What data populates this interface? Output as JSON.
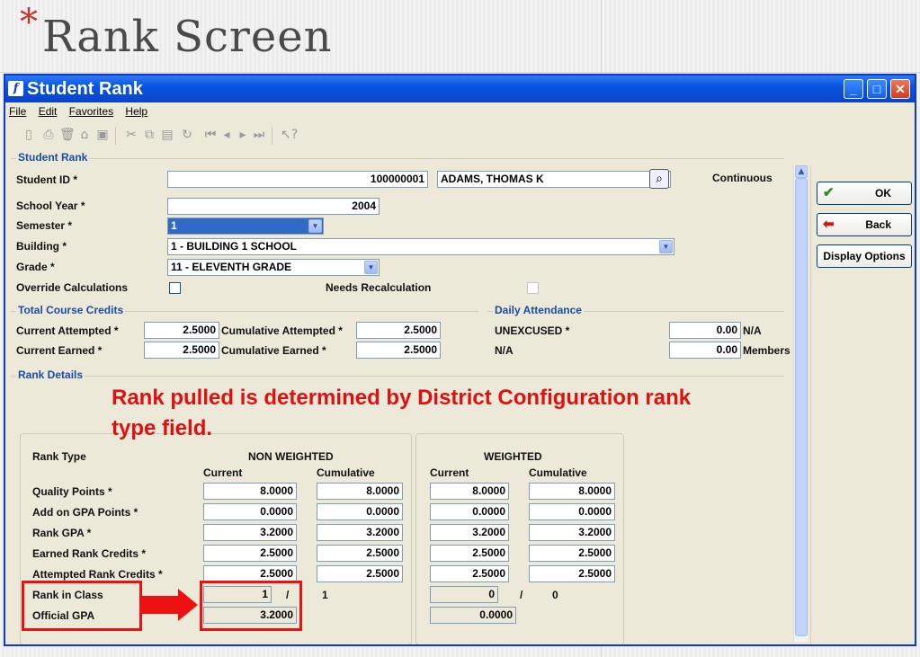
{
  "slide": {
    "title": "Rank Screen",
    "bullet": "*"
  },
  "window": {
    "title": "Student Rank",
    "minimize": "_",
    "maximize": "□",
    "close": "✕"
  },
  "menu": [
    "File",
    "Edit",
    "Favorites",
    "Help"
  ],
  "student_rank": {
    "legend": "Student Rank",
    "student_id_label": "Student ID *",
    "student_id": "100000001",
    "student_name": "ADAMS, THOMAS K",
    "continuous": "Continuous",
    "school_year_label": "School Year *",
    "school_year": "2004",
    "semester_label": "Semester *",
    "semester": "1",
    "building_label": "Building *",
    "building": "1 - BUILDING 1 SCHOOL",
    "grade_label": "Grade *",
    "grade": "11 - ELEVENTH GRADE",
    "override_label": "Override Calculations",
    "needs_recalc_label": "Needs Recalculation"
  },
  "credits": {
    "legend": "Total Course Credits",
    "current_attempted_label": "Current Attempted *",
    "current_attempted": "2.5000",
    "cumulative_attempted_label": "Cumulative Attempted *",
    "cumulative_attempted": "2.5000",
    "current_earned_label": "Current Earned *",
    "current_earned": "2.5000",
    "cumulative_earned_label": "Cumulative Earned *",
    "cumulative_earned": "2.5000"
  },
  "attendance": {
    "legend": "Daily Attendance",
    "unexcused_label": "UNEXCUSED *",
    "unexcused": "0.00",
    "unexcused_unit": "N/A",
    "na_label": "N/A",
    "na_value": "0.00",
    "na_unit": "Members"
  },
  "rank_details": {
    "legend": "Rank Details",
    "rank_type_label": "Rank Type",
    "non_weighted": "NON WEIGHTED",
    "weighted": "WEIGHTED",
    "current": "Current",
    "cumulative": "Cumulative",
    "rows": [
      {
        "label": "Quality Points *",
        "nw_cur": "8.0000",
        "nw_cum": "8.0000",
        "w_cur": "8.0000",
        "w_cum": "8.0000"
      },
      {
        "label": "Add on GPA Points *",
        "nw_cur": "0.0000",
        "nw_cum": "0.0000",
        "w_cur": "0.0000",
        "w_cum": "0.0000"
      },
      {
        "label": "Rank GPA *",
        "nw_cur": "3.2000",
        "nw_cum": "3.2000",
        "w_cur": "3.2000",
        "w_cum": "3.2000"
      },
      {
        "label": "Earned Rank Credits *",
        "nw_cur": "2.5000",
        "nw_cum": "2.5000",
        "w_cur": "2.5000",
        "w_cum": "2.5000"
      },
      {
        "label": "Attempted Rank Credits *",
        "nw_cur": "2.5000",
        "nw_cum": "2.5000",
        "w_cur": "2.5000",
        "w_cum": "2.5000"
      }
    ],
    "rank_in_class_label": "Rank in Class",
    "nw_rank": "1",
    "nw_rank_sep": "/",
    "nw_class_size": "1",
    "w_rank": "0",
    "w_rank_sep": "/",
    "w_class_size": "0",
    "official_gpa_label": "Official GPA",
    "nw_official_gpa": "3.2000",
    "w_official_gpa": "0.0000"
  },
  "annotation": {
    "line1": "Rank pulled is determined by District Configuration rank",
    "line2": "type field."
  },
  "side_buttons": {
    "ok": "OK",
    "back": "Back",
    "display_options": "Display Options"
  },
  "icons": [
    "app-icon",
    "new-icon",
    "print-icon",
    "delete-icon",
    "open-icon",
    "save-icon",
    "cut-icon",
    "copy-icon",
    "paste-icon",
    "refresh-icon",
    "first-icon",
    "prev-icon",
    "next-icon",
    "last-icon",
    "help-icon",
    "search-icon",
    "ok-check-icon",
    "back-arrow-icon"
  ],
  "colors": {
    "titlebar": "#0a54e0",
    "annotation": "#ee1111",
    "legend": "#1a4ca8"
  }
}
